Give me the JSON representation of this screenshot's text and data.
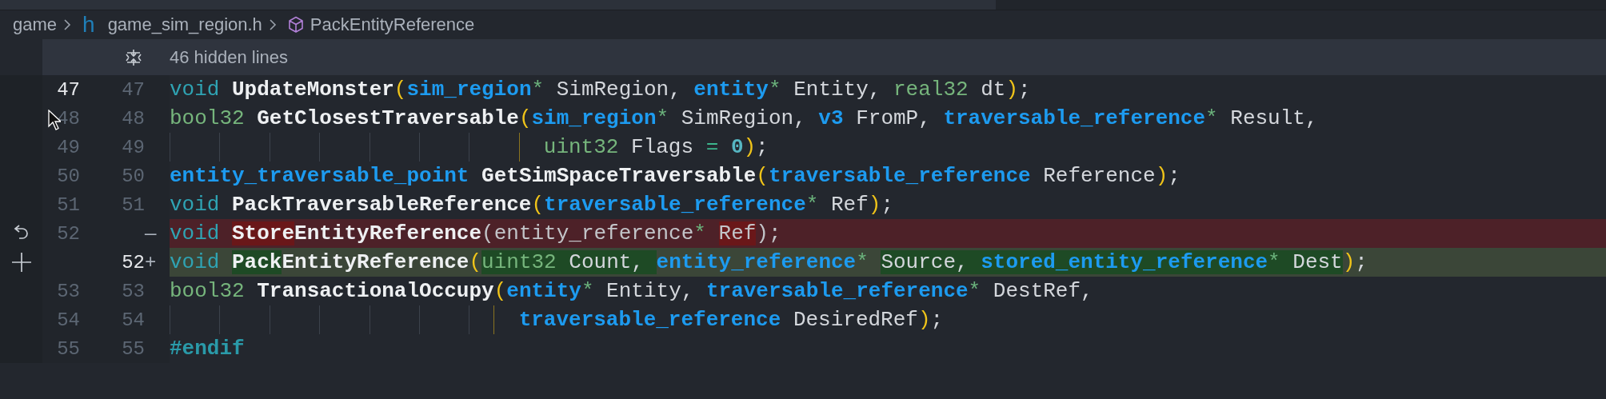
{
  "breadcrumb": [
    {
      "kind": "folder",
      "text": "game"
    },
    {
      "kind": "file",
      "icon_text": "h",
      "text": "game_sim_region.h"
    },
    {
      "kind": "symbol",
      "text": "PackEntityReference"
    }
  ],
  "hidden_lines": {
    "text": "46 hidden lines"
  },
  "lines": [
    {
      "old": {
        "text": "47",
        "bright": true
      },
      "new": {
        "text": "47",
        "bright": false
      },
      "tokens": [
        {
          "text": "void ",
          "kind": "kw"
        },
        {
          "text": "UpdateMonster",
          "kind": "fn"
        },
        {
          "text": "(",
          "kind": "paren"
        },
        {
          "text": "sim_region",
          "kind": "type"
        },
        {
          "text": "*",
          "kind": "star"
        },
        {
          "text": " SimRegion, ",
          "kind": "id"
        },
        {
          "text": "entity",
          "kind": "type"
        },
        {
          "text": "*",
          "kind": "star"
        },
        {
          "text": " Entity, ",
          "kind": "id"
        },
        {
          "text": "real32",
          "kind": "prim"
        },
        {
          "text": " dt",
          "kind": "id"
        },
        {
          "text": ")",
          "kind": "paren"
        },
        {
          "text": ";",
          "kind": "id"
        }
      ]
    },
    {
      "old": {
        "text": "48",
        "bright": false
      },
      "new": {
        "text": "48",
        "bright": false
      },
      "tokens": [
        {
          "text": "bool32 ",
          "kind": "prim"
        },
        {
          "text": "GetClosestTraversable",
          "kind": "fn"
        },
        {
          "text": "(",
          "kind": "paren"
        },
        {
          "text": "sim_region",
          "kind": "type"
        },
        {
          "text": "*",
          "kind": "star"
        },
        {
          "text": " SimRegion, ",
          "kind": "id"
        },
        {
          "text": "v3",
          "kind": "type"
        },
        {
          "text": " FromP, ",
          "kind": "id"
        },
        {
          "text": "traversable_reference",
          "kind": "type"
        },
        {
          "text": "*",
          "kind": "star"
        },
        {
          "text": " Result,",
          "kind": "id"
        }
      ]
    },
    {
      "old": {
        "text": "49",
        "bright": false
      },
      "new": {
        "text": "49",
        "bright": false
      },
      "continuation": true,
      "tokens": [
        {
          "text": "uint32",
          "kind": "prim"
        },
        {
          "text": " Flags ",
          "kind": "id"
        },
        {
          "text": "= ",
          "kind": "op"
        },
        {
          "text": "0",
          "kind": "num"
        },
        {
          "text": ")",
          "kind": "paren"
        },
        {
          "text": ";",
          "kind": "id"
        }
      ]
    },
    {
      "old": {
        "text": "50",
        "bright": false
      },
      "new": {
        "text": "50",
        "bright": false
      },
      "tokens": [
        {
          "text": "entity_traversable_point",
          "kind": "type"
        },
        {
          "text": " GetSimSpaceTraversable",
          "kind": "fn"
        },
        {
          "text": "(",
          "kind": "paren"
        },
        {
          "text": "traversable_reference",
          "kind": "type"
        },
        {
          "text": " Reference",
          "kind": "id"
        },
        {
          "text": ")",
          "kind": "paren"
        },
        {
          "text": ";",
          "kind": "id"
        }
      ]
    },
    {
      "old": {
        "text": "51",
        "bright": false
      },
      "new": {
        "text": "51",
        "bright": false
      },
      "tokens": [
        {
          "text": "void ",
          "kind": "kw"
        },
        {
          "text": "PackTraversableReference",
          "kind": "fn"
        },
        {
          "text": "(",
          "kind": "paren"
        },
        {
          "text": "traversable_reference",
          "kind": "type"
        },
        {
          "text": "*",
          "kind": "star"
        },
        {
          "text": " Ref",
          "kind": "id"
        },
        {
          "text": ")",
          "kind": "paren"
        },
        {
          "text": ";",
          "kind": "id"
        }
      ]
    },
    {
      "old": {
        "text": "52",
        "bright": false
      },
      "marker": "—",
      "revertible": true,
      "deleted": true,
      "tokens": [
        {
          "text": "void ",
          "kind": "kw"
        },
        {
          "text": "Store",
          "kind": "fn",
          "hl": true
        },
        {
          "text": "EntityReference",
          "kind": "fn"
        },
        {
          "text": "(entity_reference",
          "kind": "id"
        },
        {
          "text": "* ",
          "kind": "star"
        },
        {
          "text": "Ref",
          "kind": "id",
          "hl": true
        },
        {
          "text": ");",
          "kind": "id"
        }
      ]
    },
    {
      "new": {
        "text": "52",
        "bright": true
      },
      "marker": "+",
      "commentable": true,
      "inserted": true,
      "tokens": [
        {
          "text": "void ",
          "kind": "kw"
        },
        {
          "text": "Pack",
          "kind": "fn",
          "hl": true
        },
        {
          "text": "EntityReference",
          "kind": "fn"
        },
        {
          "text": "(",
          "kind": "paren"
        },
        {
          "text": "uint32",
          "kind": "prim",
          "hl": true
        },
        {
          "text": " Count, ",
          "kind": "id",
          "hl": true
        },
        {
          "text": "entity_reference",
          "kind": "type"
        },
        {
          "text": "* ",
          "kind": "star"
        },
        {
          "text": "Source, ",
          "kind": "id",
          "hl": true
        },
        {
          "text": "stored_entity_reference",
          "kind": "type",
          "hl": true
        },
        {
          "text": "*",
          "kind": "star",
          "hl": true
        },
        {
          "text": " Dest",
          "kind": "id",
          "hl": true
        },
        {
          "text": ")",
          "kind": "paren"
        },
        {
          "text": ";",
          "kind": "id"
        }
      ]
    },
    {
      "old": {
        "text": "53",
        "bright": false
      },
      "new": {
        "text": "53",
        "bright": false
      },
      "tokens": [
        {
          "text": "bool32 ",
          "kind": "prim"
        },
        {
          "text": "TransactionalOccupy",
          "kind": "fn"
        },
        {
          "text": "(",
          "kind": "paren"
        },
        {
          "text": "entity",
          "kind": "type"
        },
        {
          "text": "*",
          "kind": "star"
        },
        {
          "text": " Entity, ",
          "kind": "id"
        },
        {
          "text": "traversable_reference",
          "kind": "type"
        },
        {
          "text": "*",
          "kind": "star"
        },
        {
          "text": " DestRef,",
          "kind": "id"
        }
      ]
    },
    {
      "old": {
        "text": "54",
        "bright": false
      },
      "new": {
        "text": "54",
        "bright": false
      },
      "continuation": true,
      "tokens": [
        {
          "text": "traversable_reference",
          "kind": "type"
        },
        {
          "text": " DesiredRef",
          "kind": "id"
        },
        {
          "text": ")",
          "kind": "paren"
        },
        {
          "text": ";",
          "kind": "id"
        }
      ]
    },
    {
      "old": {
        "text": "55",
        "bright": false
      },
      "new": {
        "text": "55",
        "bright": false
      },
      "tokens": [
        {
          "text": "#endif",
          "kind": "macro"
        }
      ]
    }
  ]
}
